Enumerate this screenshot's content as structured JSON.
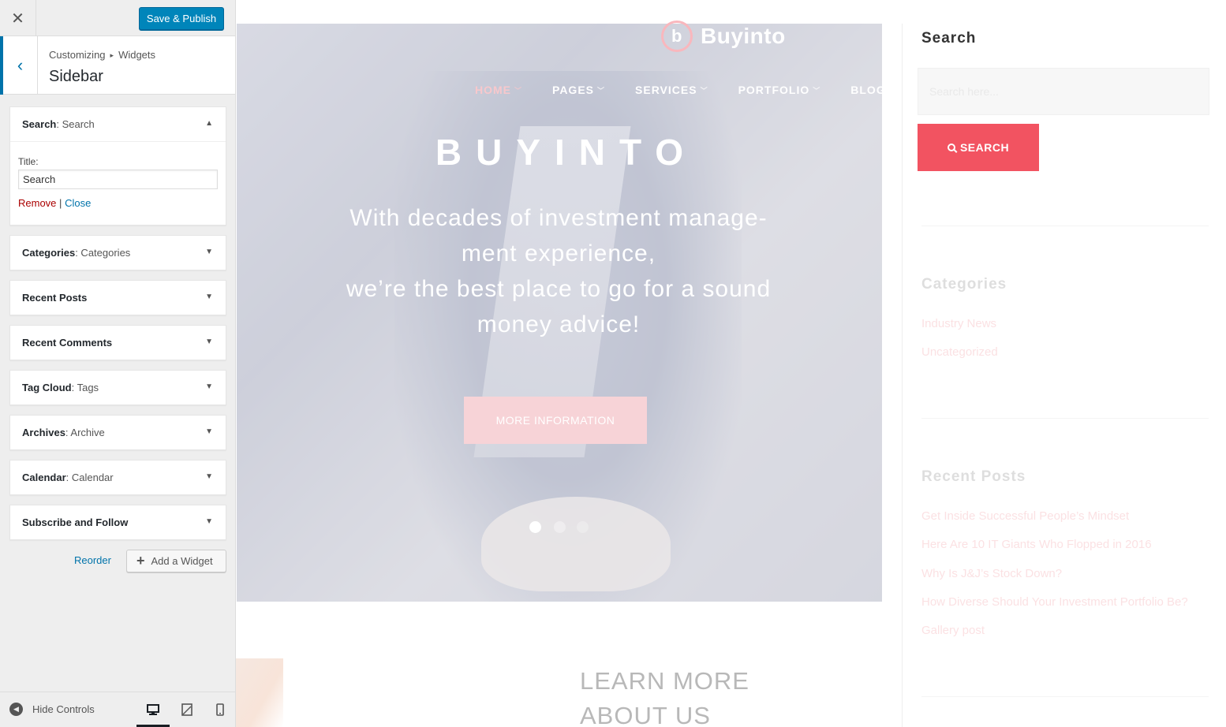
{
  "customizer": {
    "close_label": "✕",
    "save_label": "Save & Publish",
    "breadcrumb": [
      "Customizing",
      "Widgets"
    ],
    "breadcrumb_sep": "▸",
    "section_title": "Sidebar",
    "widgets": [
      {
        "name": "Search",
        "title": ": Search",
        "expanded": true
      },
      {
        "name": "Categories",
        "title": ": Categories",
        "expanded": false
      },
      {
        "name": "Recent Posts",
        "title": "",
        "expanded": false
      },
      {
        "name": "Recent Comments",
        "title": "",
        "expanded": false
      },
      {
        "name": "Tag Cloud",
        "title": ": Tags",
        "expanded": false
      },
      {
        "name": "Archives",
        "title": ": Archive",
        "expanded": false
      },
      {
        "name": "Calendar",
        "title": ": Calendar",
        "expanded": false
      },
      {
        "name": "Subscribe and Follow",
        "title": "",
        "expanded": false
      }
    ],
    "search_widget": {
      "field_label": "Title:",
      "field_value": "Search",
      "remove_label": "Remove",
      "sep": "|",
      "close_label": "Close"
    },
    "reorder_label": "Reorder",
    "add_widget_label": "Add a Widget",
    "hide_controls_label": "Hide Controls",
    "active_device": "desktop"
  },
  "preview": {
    "logo_text": "Buyinto",
    "logo_mark": "b",
    "nav": [
      {
        "label": "HOME",
        "active": true
      },
      {
        "label": "PAGES",
        "active": false
      },
      {
        "label": "SERVICES",
        "active": false
      },
      {
        "label": "PORTFOLIO",
        "active": false
      },
      {
        "label": "BLOG",
        "active": false
      }
    ],
    "hero_title": "BUYINTO",
    "hero_text_1": "With decades of investment manage-",
    "hero_text_2": "ment experience,",
    "hero_text_3": "we’re the best place to go for a sound",
    "hero_text_4": "money advice!",
    "hero_button": "MORE INFORMATION",
    "learn_more_1": "LEARN MORE",
    "learn_more_2": "ABOUT US",
    "sidebar": {
      "search_heading": "Search",
      "search_placeholder": "Search here...",
      "search_button": "SEARCH",
      "categories_heading": "Categories",
      "categories": [
        "Industry News",
        "Uncategorized"
      ],
      "recent_heading": "Recent Posts",
      "recent_posts": [
        "Get Inside Successful People’s Mindset",
        "Here Are 10 IT Giants Who Flopped in 2016",
        "Why Is J&J’s Stock Down?",
        "How Diverse Should Your Investment Portfolio Be?",
        "Gallery post"
      ]
    }
  },
  "colors": {
    "wp_blue": "#0085ba",
    "accent_red": "#f25361",
    "remove_red": "#aa0000"
  }
}
